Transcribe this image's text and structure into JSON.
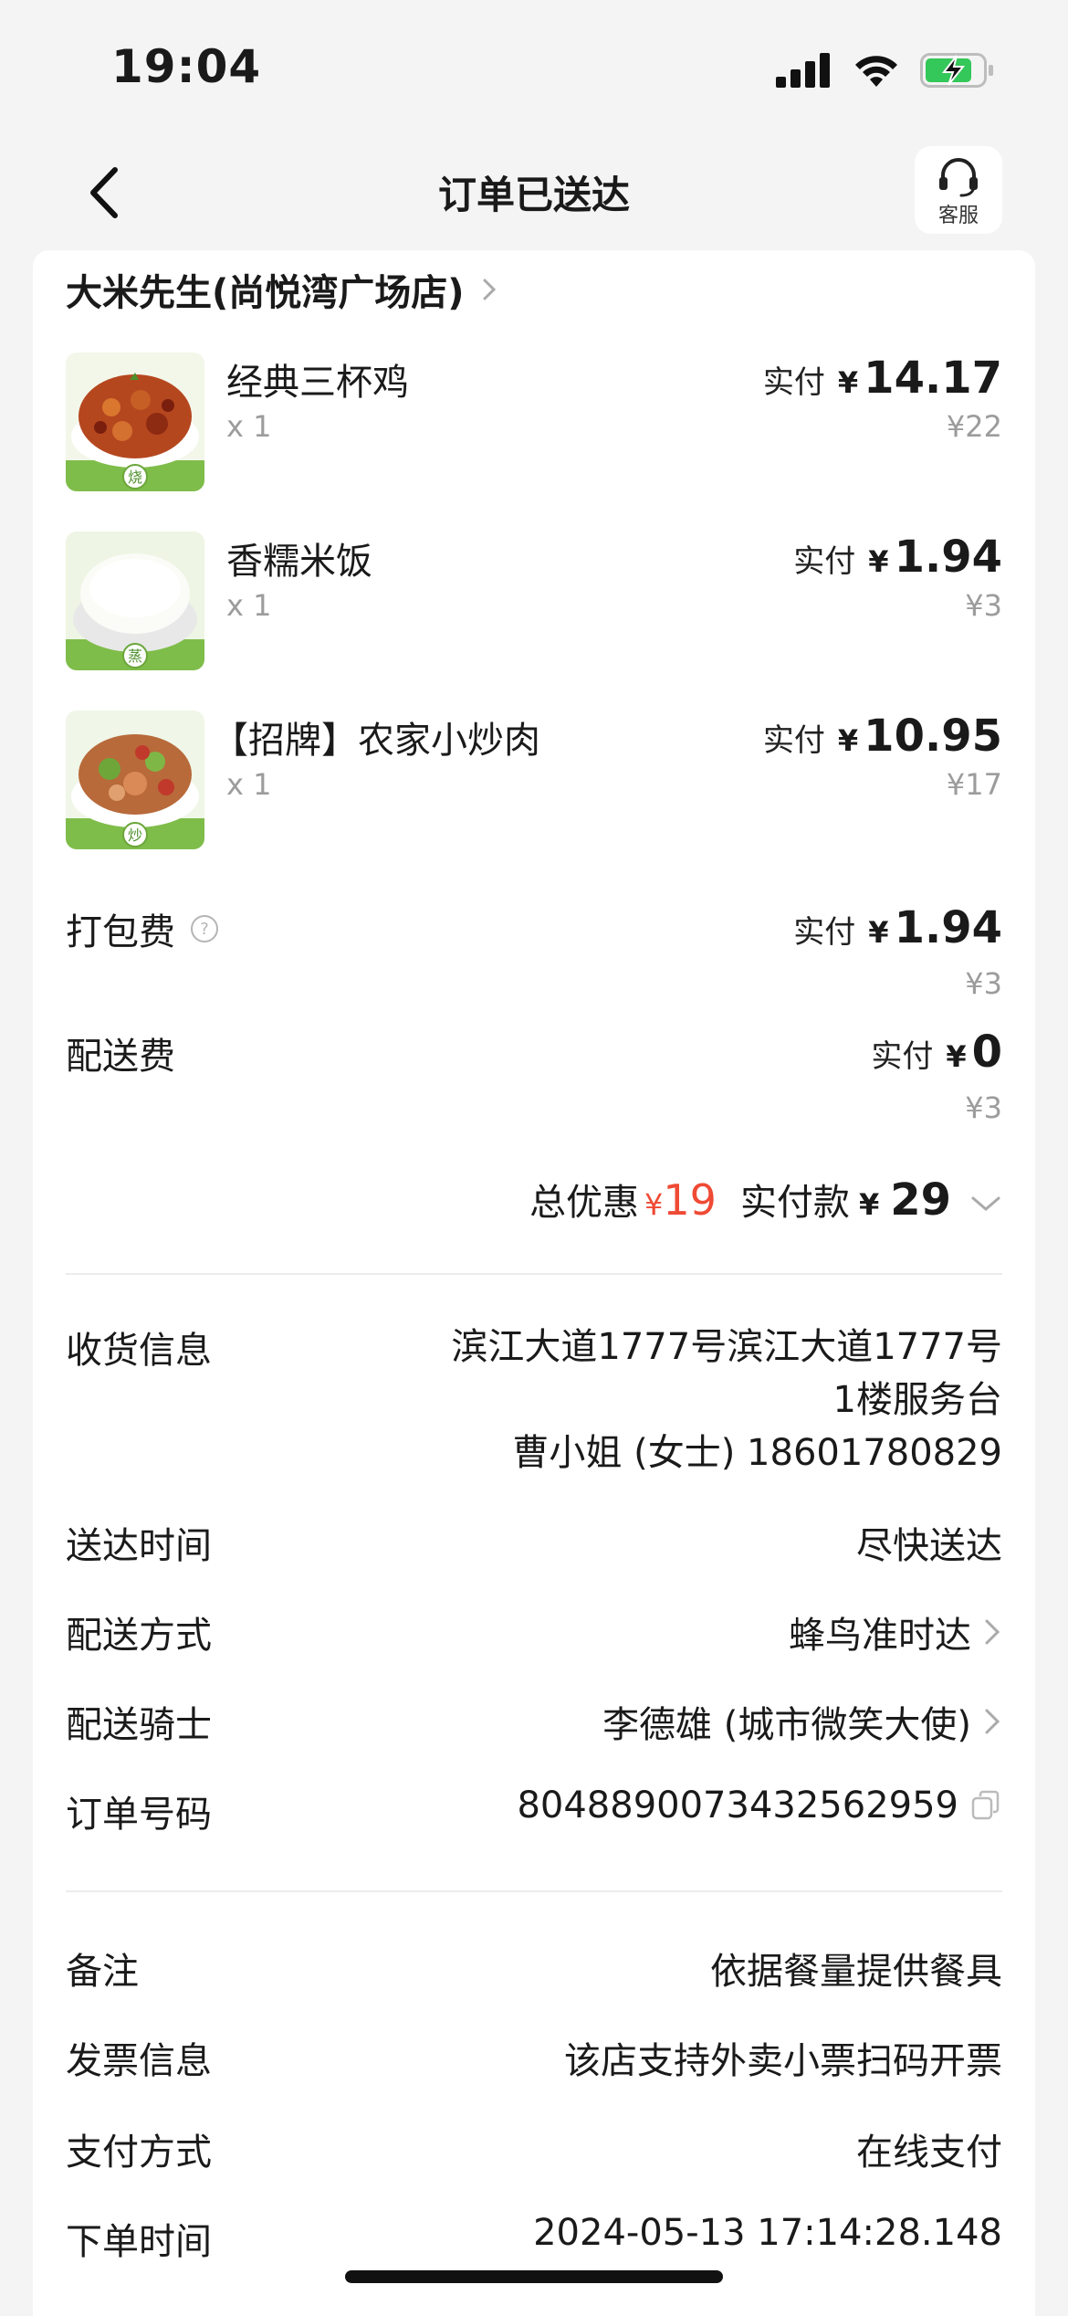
{
  "status_bar": {
    "time": "19:04"
  },
  "nav": {
    "title": "订单已送达",
    "customer_service_label": "客服"
  },
  "shop": {
    "name": "大米先生(尚悦湾广场店)"
  },
  "items": [
    {
      "name": "经典三杯鸡",
      "qty": "x 1",
      "paid_label": "实付",
      "currency": "¥",
      "paid": "14.17",
      "original": "¥22",
      "badge": "烧"
    },
    {
      "name": "香糯米饭",
      "qty": "x 1",
      "paid_label": "实付",
      "currency": "¥",
      "paid": "1.94",
      "original": "¥3",
      "badge": "蒸"
    },
    {
      "name": "【招牌】农家小炒肉",
      "qty": "x 1",
      "paid_label": "实付",
      "currency": "¥",
      "paid": "10.95",
      "original": "¥17",
      "badge": "炒"
    }
  ],
  "fees": {
    "packaging": {
      "label": "打包费",
      "paid_label": "实付",
      "currency": "¥",
      "paid": "1.94",
      "original": "¥3"
    },
    "delivery": {
      "label": "配送费",
      "paid_label": "实付",
      "currency": "¥",
      "paid": "0",
      "original": "¥3"
    }
  },
  "summary": {
    "discount_label": "总优惠",
    "discount_currency": "¥",
    "discount": "19",
    "paid_label": "实付款",
    "paid_currency": "¥",
    "paid": "29"
  },
  "delivery_info": {
    "address_label": "收货信息",
    "address_line1": "滨江大道1777号滨江大道1777号",
    "address_line2": "1楼服务台",
    "contact": "曹小姐 (女士) 18601780829",
    "time_label": "送达时间",
    "time_value": "尽快送达",
    "method_label": "配送方式",
    "method_value": "蜂鸟准时达",
    "rider_label": "配送骑士",
    "rider_value": "李德雄 (城市微笑大使)",
    "order_no_label": "订单号码",
    "order_no_value": "8048890073432562959"
  },
  "other_info": {
    "note_label": "备注",
    "note_value": "依据餐量提供餐具",
    "invoice_label": "发票信息",
    "invoice_value": "该店支持外卖小票扫码开票",
    "payment_label": "支付方式",
    "payment_value": "在线支付",
    "order_time_label": "下单时间",
    "order_time_value": "2024-05-13 17:14:28.148"
  },
  "colors": {
    "accent_red": "#ef4a34",
    "battery_green": "#34c759",
    "muted": "#9c9c9c"
  }
}
